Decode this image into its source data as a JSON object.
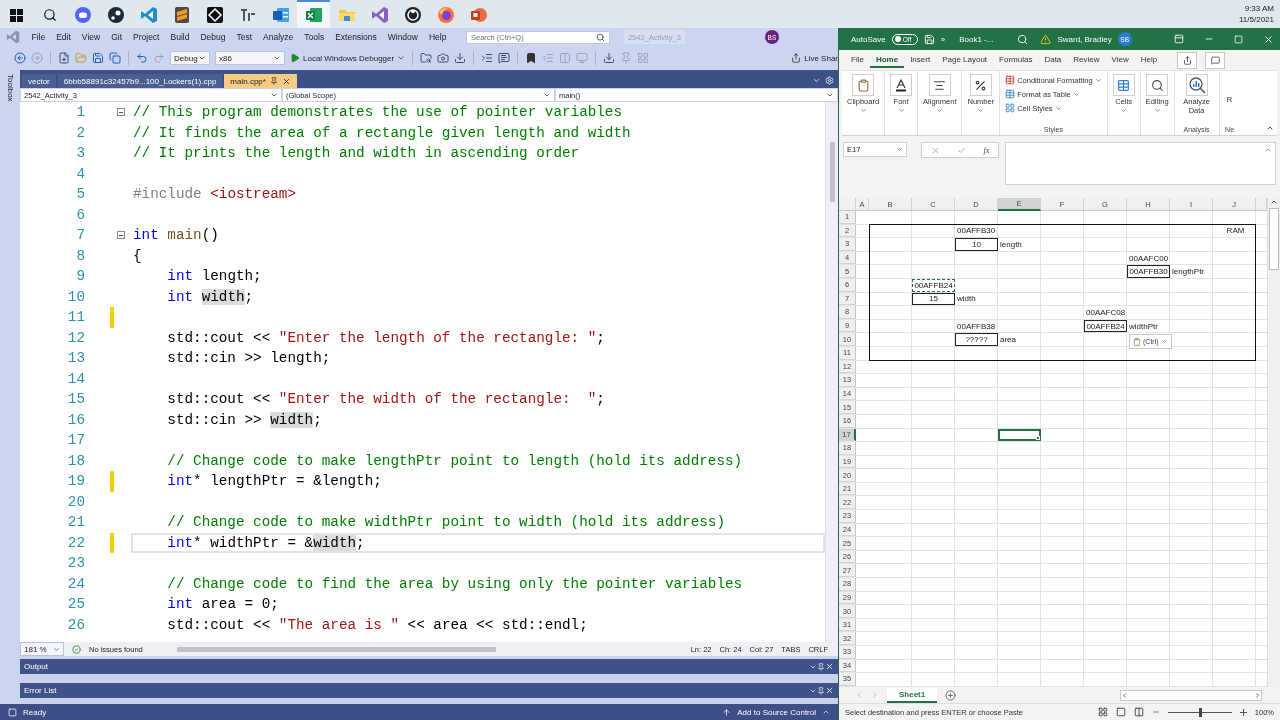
{
  "taskbar": {
    "apps": [
      {
        "kind": "chat",
        "selected": false
      },
      {
        "kind": "steam",
        "selected": false
      },
      {
        "kind": "code",
        "selected": false
      },
      {
        "kind": "sublime",
        "selected": false
      },
      {
        "kind": "unity",
        "selected": false
      },
      {
        "kind": "typora",
        "selected": false
      },
      {
        "kind": "word",
        "selected": false
      },
      {
        "kind": "excel",
        "selected": true
      },
      {
        "kind": "files",
        "selected": false
      },
      {
        "kind": "studio",
        "selected": false
      },
      {
        "kind": "obs",
        "selected": false
      },
      {
        "kind": "firefox",
        "selected": false
      },
      {
        "kind": "slides",
        "selected": false
      }
    ],
    "clock": {
      "time": "9:33 AM",
      "date": "11/5/2021"
    }
  },
  "vs": {
    "menus": [
      "File",
      "Edit",
      "View",
      "Git",
      "Project",
      "Build",
      "Debug",
      "Test",
      "Analyze",
      "Tools",
      "Extensions",
      "Window",
      "Help"
    ],
    "search": {
      "placeholder": "Search (Ctrl+Q)"
    },
    "solution_title": "2542_Activity_3",
    "avatar": "BS",
    "toolbar": {
      "configuration": "Debug",
      "platform": "x86",
      "debugger": "Local Windows Debugger",
      "live_share": "Live Shar"
    },
    "toolbox": "Toolbox",
    "tabs": [
      {
        "label": "vector",
        "selected": false
      },
      {
        "label": "6bbb58891c32457b9...100_Lockers(1).cpp",
        "selected": false
      },
      {
        "label": "main.cpp*",
        "selected": true
      }
    ],
    "nav": {
      "project": "2542_Activity_3",
      "scope": "(Global Scope)",
      "member": "main()"
    },
    "code": [
      {
        "number": "1",
        "fold": true,
        "modified": false,
        "current": false,
        "tokens": [
          {
            "kind": "comment",
            "s": "// This program demonstrates the use of pointer variables"
          }
        ]
      },
      {
        "number": "2",
        "fold": false,
        "modified": false,
        "current": false,
        "tokens": [
          {
            "kind": "comment",
            "s": "// It finds the area of a rectangle given length and width"
          }
        ]
      },
      {
        "number": "3",
        "fold": false,
        "modified": false,
        "current": false,
        "tokens": [
          {
            "kind": "comment",
            "s": "// It prints the length and width in ascending order"
          }
        ]
      },
      {
        "number": "4",
        "fold": false,
        "modified": false,
        "current": false
      },
      {
        "number": "5",
        "fold": false,
        "modified": false,
        "current": false,
        "tokens": [
          {
            "kind": "preproc",
            "s": "#include "
          },
          {
            "kind": "string",
            "s": "<iostream>"
          }
        ]
      },
      {
        "number": "6",
        "fold": false,
        "modified": false,
        "current": false
      },
      {
        "number": "7",
        "fold": true,
        "modified": false,
        "current": false,
        "tokens": [
          {
            "kind": "keyword",
            "s": "int "
          },
          {
            "kind": "func",
            "s": "main"
          },
          {
            "kind": "plain",
            "s": "()"
          }
        ]
      },
      {
        "number": "8",
        "fold": false,
        "modified": false,
        "current": false,
        "tokens": [
          {
            "kind": "plain",
            "s": "{"
          }
        ]
      },
      {
        "number": "9",
        "fold": false,
        "modified": false,
        "current": false,
        "tokens": [
          {
            "kind": "keyword",
            "s": "    int "
          },
          {
            "kind": "plain",
            "s": "length;"
          }
        ]
      },
      {
        "number": "10",
        "fold": false,
        "modified": false,
        "current": false,
        "tokens": [
          {
            "kind": "keyword",
            "s": "    int "
          },
          {
            "kind": "ref",
            "s": "width"
          },
          {
            "kind": "plain",
            "s": ";"
          }
        ]
      },
      {
        "number": "11",
        "fold": false,
        "modified": true,
        "current": false
      },
      {
        "number": "12",
        "fold": false,
        "modified": false,
        "current": false,
        "tokens": [
          {
            "kind": "plain",
            "s": "    std::cout << "
          },
          {
            "kind": "string",
            "s": "\"Enter the length of the rectangle: \""
          },
          {
            "kind": "plain",
            "s": ";"
          }
        ]
      },
      {
        "number": "13",
        "fold": false,
        "modified": false,
        "current": false,
        "tokens": [
          {
            "kind": "plain",
            "s": "    std::cin >> length;"
          }
        ]
      },
      {
        "number": "14",
        "fold": false,
        "modified": false,
        "current": false
      },
      {
        "number": "15",
        "fold": false,
        "modified": false,
        "current": false,
        "tokens": [
          {
            "kind": "plain",
            "s": "    std::cout << "
          },
          {
            "kind": "string",
            "s": "\"Enter the width of the rectangle:  \""
          },
          {
            "kind": "plain",
            "s": ";"
          }
        ]
      },
      {
        "number": "16",
        "fold": false,
        "modified": false,
        "current": false,
        "tokens": [
          {
            "kind": "plain",
            "s": "    std::cin >> "
          },
          {
            "kind": "ref",
            "s": "width"
          },
          {
            "kind": "plain",
            "s": ";"
          }
        ]
      },
      {
        "number": "17",
        "fold": false,
        "modified": false,
        "current": false
      },
      {
        "number": "18",
        "fold": false,
        "modified": false,
        "current": false,
        "tokens": [
          {
            "kind": "comment",
            "s": "    // Change code to make lengthPtr point to length (hold its address)"
          }
        ]
      },
      {
        "number": "19",
        "fold": false,
        "modified": true,
        "current": false,
        "tokens": [
          {
            "kind": "keyword",
            "s": "    int"
          },
          {
            "kind": "plain",
            "s": "* lengthPtr = &length;"
          }
        ]
      },
      {
        "number": "20",
        "fold": false,
        "modified": false,
        "current": false
      },
      {
        "number": "21",
        "fold": false,
        "modified": false,
        "current": false,
        "tokens": [
          {
            "kind": "comment",
            "s": "    // Change code to make widthPtr point to width (hold its address)"
          }
        ]
      },
      {
        "number": "22",
        "fold": false,
        "modified": true,
        "current": true,
        "tokens": [
          {
            "kind": "keyword",
            "s": "    int"
          },
          {
            "kind": "plain",
            "s": "* widthPtr = &"
          },
          {
            "kind": "ref",
            "s": "width"
          },
          {
            "kind": "plain",
            "s": ";"
          }
        ]
      },
      {
        "number": "23",
        "fold": false,
        "modified": false,
        "current": false
      },
      {
        "number": "24",
        "fold": false,
        "modified": false,
        "current": false,
        "tokens": [
          {
            "kind": "comment",
            "s": "    // Change code to find the area by using only the pointer variables"
          }
        ]
      },
      {
        "number": "25",
        "fold": false,
        "modified": false,
        "current": false,
        "tokens": [
          {
            "kind": "keyword",
            "s": "    int "
          },
          {
            "kind": "plain",
            "s": "area = 0;"
          }
        ]
      },
      {
        "number": "26",
        "fold": false,
        "modified": false,
        "current": false,
        "tokens": [
          {
            "kind": "plain",
            "s": "    std::cout << "
          },
          {
            "kind": "string",
            "s": "\"The area is \""
          },
          {
            "kind": "plain",
            "s": " << area << std::endl;"
          }
        ]
      }
    ],
    "status": {
      "zoom": "181 %",
      "issues": "No issues found",
      "line": "Ln: 22",
      "char": "Ch: 24",
      "col": "Col: 27",
      "indent": "TABS",
      "eol": "CRLF"
    },
    "panels": [
      {
        "title": "Output"
      },
      {
        "title": "Error List"
      }
    ],
    "status_bar": {
      "state": "Ready",
      "source_control": "Add to Source Control"
    }
  },
  "excel": {
    "autosave": {
      "label": "AutoSave",
      "on": false,
      "state": "Off"
    },
    "more": "»",
    "title": "Book1 -...",
    "user": "Sward, Bradley",
    "avatar": "SB",
    "tabs": [
      {
        "label": "File",
        "selected": false
      },
      {
        "label": "Home",
        "selected": true
      },
      {
        "label": "Insert",
        "selected": false
      },
      {
        "label": "Page Layout",
        "selected": false
      },
      {
        "label": "Formulas",
        "selected": false
      },
      {
        "label": "Data",
        "selected": false
      },
      {
        "label": "Review",
        "selected": false
      },
      {
        "label": "View",
        "selected": false
      },
      {
        "label": "Help",
        "selected": false
      }
    ],
    "ribbon": {
      "buttons": [
        {
          "label": "Clipboard",
          "kind": "clipboard"
        },
        {
          "label": "Font",
          "kind": "font"
        },
        {
          "label": "Alignment",
          "kind": "alignment"
        },
        {
          "label": "Number",
          "kind": "number"
        }
      ],
      "styles": {
        "items": [
          "Conditional Formatting",
          "Format as Table",
          "Cell Styles"
        ],
        "group": "Styles"
      },
      "tools": [
        {
          "label": "Cells",
          "kind": "cells"
        },
        {
          "label": "Editing",
          "kind": "editing"
        }
      ],
      "analyze": {
        "label": "Analyze Data",
        "group": "Analysis"
      },
      "cut": {
        "label": "R",
        "group": "Ne"
      }
    },
    "name_box": "E17",
    "function_label": "fx",
    "columns": [
      {
        "label": "A",
        "selected": false
      },
      {
        "label": "B",
        "selected": false
      },
      {
        "label": "C",
        "selected": false
      },
      {
        "label": "D",
        "selected": false
      },
      {
        "label": "E",
        "selected": true
      },
      {
        "label": "F",
        "selected": false
      },
      {
        "label": "G",
        "selected": false
      },
      {
        "label": "H",
        "selected": false
      },
      {
        "label": "I",
        "selected": false
      },
      {
        "label": "J",
        "selected": false
      }
    ],
    "rows": [
      {
        "label": "1",
        "selected": false
      },
      {
        "label": "2",
        "selected": false,
        "cells": [
          {
            "kind": "empty"
          },
          {
            "kind": "empty"
          },
          {
            "kind": "empty"
          },
          {
            "kind": "plain",
            "text": "00AFFB30"
          },
          {
            "kind": "empty"
          },
          {
            "kind": "empty"
          },
          {
            "kind": "empty"
          },
          {
            "kind": "empty"
          },
          {
            "kind": "empty"
          },
          {
            "kind": "centered",
            "text": "RAM"
          }
        ]
      },
      {
        "label": "3",
        "selected": false,
        "cells": [
          {
            "kind": "empty"
          },
          {
            "kind": "empty"
          },
          {
            "kind": "empty"
          },
          {
            "kind": "boxed",
            "text": "10"
          },
          {
            "kind": "plain",
            "text": "length"
          }
        ]
      },
      {
        "label": "4",
        "selected": false,
        "cells": [
          {
            "kind": "empty"
          },
          {
            "kind": "empty"
          },
          {
            "kind": "empty"
          },
          {
            "kind": "empty"
          },
          {
            "kind": "empty"
          },
          {
            "kind": "empty"
          },
          {
            "kind": "empty"
          },
          {
            "kind": "plain",
            "text": "00AAFC00"
          }
        ]
      },
      {
        "label": "5",
        "selected": false,
        "cells": [
          {
            "kind": "empty"
          },
          {
            "kind": "empty"
          },
          {
            "kind": "empty"
          },
          {
            "kind": "empty"
          },
          {
            "kind": "empty"
          },
          {
            "kind": "empty"
          },
          {
            "kind": "empty"
          },
          {
            "kind": "boxed",
            "text": "00AFFB30"
          },
          {
            "kind": "plain",
            "text": "lengthPtr"
          }
        ]
      },
      {
        "label": "6",
        "selected": false,
        "cells": [
          {
            "kind": "empty"
          },
          {
            "kind": "empty"
          },
          {
            "kind": "copied",
            "text": "00AFFB24"
          }
        ]
      },
      {
        "label": "7",
        "selected": false,
        "cells": [
          {
            "kind": "empty"
          },
          {
            "kind": "empty"
          },
          {
            "kind": "boxed",
            "text": "15"
          },
          {
            "kind": "plain",
            "text": "width"
          }
        ]
      },
      {
        "label": "8",
        "selected": false,
        "cells": [
          {
            "kind": "empty"
          },
          {
            "kind": "empty"
          },
          {
            "kind": "empty"
          },
          {
            "kind": "empty"
          },
          {
            "kind": "empty"
          },
          {
            "kind": "empty"
          },
          {
            "kind": "plain",
            "text": "00AAFC08"
          }
        ]
      },
      {
        "label": "9",
        "selected": false,
        "cells": [
          {
            "kind": "empty"
          },
          {
            "kind": "empty"
          },
          {
            "kind": "empty"
          },
          {
            "kind": "plain",
            "text": "00AFFB38"
          },
          {
            "kind": "empty"
          },
          {
            "kind": "empty"
          },
          {
            "kind": "boxed",
            "text": "00AFFB24"
          },
          {
            "kind": "plain",
            "text": "widthPtr"
          }
        ]
      },
      {
        "label": "10",
        "selected": false,
        "cells": [
          {
            "kind": "empty"
          },
          {
            "kind": "empty"
          },
          {
            "kind": "empty"
          },
          {
            "kind": "boxed",
            "text": "?????"
          },
          {
            "kind": "plain",
            "text": "area"
          },
          {
            "kind": "empty"
          },
          {
            "kind": "empty"
          },
          {
            "kind": "paste_button",
            "text": "(Ctrl)"
          }
        ]
      },
      {
        "label": "11",
        "selected": false
      },
      {
        "label": "12",
        "selected": false
      },
      {
        "label": "13",
        "selected": false
      },
      {
        "label": "14",
        "selected": false
      },
      {
        "label": "15",
        "selected": false
      },
      {
        "label": "16",
        "selected": false
      },
      {
        "label": "17",
        "selected": true
      },
      {
        "label": "18",
        "selected": false
      },
      {
        "label": "19",
        "selected": false
      },
      {
        "label": "20",
        "selected": false
      },
      {
        "label": "21",
        "selected": false
      },
      {
        "label": "22",
        "selected": false
      },
      {
        "label": "23",
        "selected": false
      },
      {
        "label": "24",
        "selected": false
      },
      {
        "label": "25",
        "selected": false
      },
      {
        "label": "26",
        "selected": false
      },
      {
        "label": "27",
        "selected": false
      },
      {
        "label": "28",
        "selected": false
      },
      {
        "label": "29",
        "selected": false
      },
      {
        "label": "30",
        "selected": false
      },
      {
        "label": "31",
        "selected": false
      },
      {
        "label": "32",
        "selected": false
      },
      {
        "label": "33",
        "selected": false
      },
      {
        "label": "34",
        "selected": false
      },
      {
        "label": "35",
        "selected": false
      }
    ],
    "sheets": [
      {
        "label": "Sheet1",
        "selected": true
      }
    ],
    "status": "Select destination and press ENTER or choose Paste",
    "zoom": {
      "level": 0.5,
      "reading": "100%"
    }
  }
}
